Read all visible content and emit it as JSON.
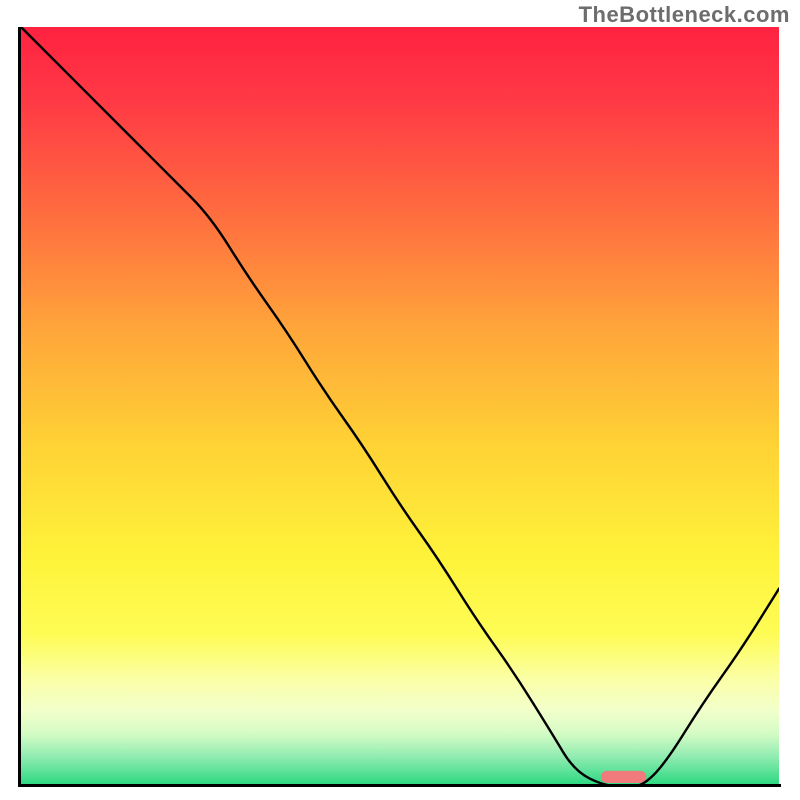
{
  "watermark": "TheBottleneck.com",
  "chart_data": {
    "type": "line",
    "title": "",
    "xlabel": "",
    "ylabel": "",
    "xlim": [
      0,
      100
    ],
    "ylim": [
      0,
      100
    ],
    "x": [
      0,
      5,
      10,
      15,
      20,
      25,
      30,
      35,
      40,
      45,
      50,
      55,
      60,
      65,
      70,
      73,
      77,
      80,
      82,
      85,
      90,
      95,
      100
    ],
    "values": [
      100,
      95,
      90,
      85,
      80,
      75,
      67,
      60,
      52,
      45,
      37,
      30,
      22,
      15,
      7,
      2,
      0,
      0,
      0,
      3,
      11,
      18,
      26
    ],
    "marker": {
      "x_range": [
        76.5,
        82.5
      ],
      "y": 1.2,
      "color": "#f17a7d",
      "shape": "pill"
    },
    "background_gradient": {
      "stops": [
        {
          "offset": 0.0,
          "color": "#ff2241"
        },
        {
          "offset": 0.1,
          "color": "#ff3a45"
        },
        {
          "offset": 0.25,
          "color": "#ff6e3f"
        },
        {
          "offset": 0.4,
          "color": "#ffa63a"
        },
        {
          "offset": 0.55,
          "color": "#ffd235"
        },
        {
          "offset": 0.7,
          "color": "#fef33a"
        },
        {
          "offset": 0.8,
          "color": "#fefc55"
        },
        {
          "offset": 0.86,
          "color": "#fbffa7"
        },
        {
          "offset": 0.9,
          "color": "#f2ffcb"
        },
        {
          "offset": 0.93,
          "color": "#d6fcc5"
        },
        {
          "offset": 0.96,
          "color": "#94edb3"
        },
        {
          "offset": 1.0,
          "color": "#28d77f"
        }
      ]
    }
  }
}
